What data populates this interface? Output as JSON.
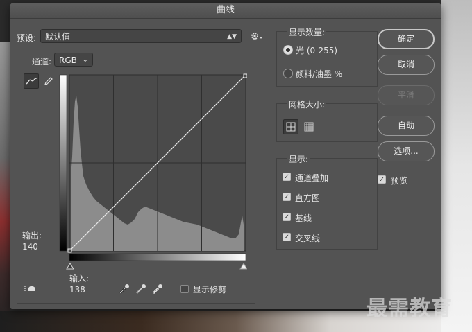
{
  "window": {
    "title": "曲线"
  },
  "preset": {
    "label": "预设:",
    "value": "默认值"
  },
  "channel": {
    "label": "通道:",
    "value": "RGB"
  },
  "graph": {
    "output_label": "输出:",
    "output_value": "140",
    "input_label": "输入:",
    "input_value": "138"
  },
  "show_clipping": {
    "label": "显示修剪",
    "checked": false
  },
  "show_amount": {
    "title": "显示数量:",
    "light": "光 (0-255)",
    "pigment": "颜料/油墨 %",
    "selected": "light"
  },
  "grid_size": {
    "title": "网格大小:"
  },
  "display": {
    "title": "显示:",
    "items": [
      {
        "label": "通道叠加",
        "checked": true
      },
      {
        "label": "直方图",
        "checked": true
      },
      {
        "label": "基线",
        "checked": true
      },
      {
        "label": "交叉线",
        "checked": true
      }
    ]
  },
  "buttons": {
    "ok": "确定",
    "cancel": "取消",
    "smooth": "平滑",
    "auto": "自动",
    "options": "选项..."
  },
  "preview": {
    "label": "预览",
    "checked": true
  },
  "watermark": "最需教育",
  "colors": {
    "dialog_bg": "#535353",
    "graph_bg": "#4a4a4a",
    "histogram": "#8c8c8c"
  }
}
